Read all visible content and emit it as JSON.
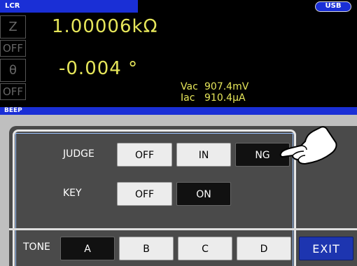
{
  "header": {
    "mode_label": "LCR",
    "usb_label": "USB"
  },
  "measurement": {
    "param1_label": "Z",
    "param1_value": "1.00006kΩ",
    "off1_label": "OFF",
    "param2_label": "θ",
    "param2_value": "-0.004 °",
    "off2_label": "OFF",
    "vac_label": "Vac",
    "vac_value": "907.4mV",
    "iac_label": "Iac",
    "iac_value": "910.4μA"
  },
  "section": {
    "title": "BEEP"
  },
  "beep": {
    "judge_label": "JUDGE",
    "judge_options": [
      "OFF",
      "IN",
      "NG"
    ],
    "judge_selected": "NG",
    "key_label": "KEY",
    "key_options": [
      "OFF",
      "ON"
    ],
    "key_selected": "ON",
    "tone_label": "TONE",
    "tone_options": [
      "A",
      "B",
      "C",
      "D"
    ],
    "tone_selected": "A",
    "exit_label": "EXIT"
  },
  "icons": {
    "pointer": "hand-pointer-icon"
  },
  "colors": {
    "accent_blue": "#1a2fd6",
    "value_yellow": "#e6e65a",
    "exit_blue": "#1d35b0"
  }
}
